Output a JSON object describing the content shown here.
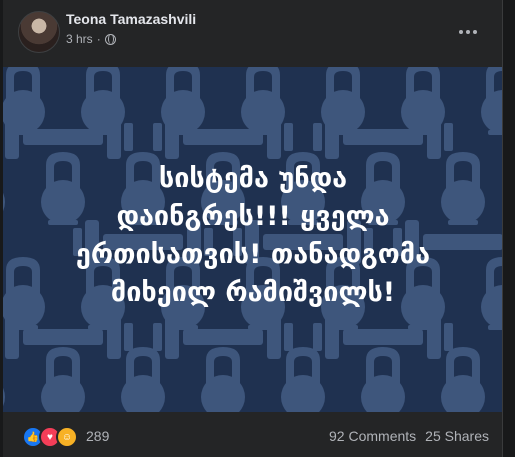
{
  "post": {
    "author": "Teona Tamazashvili",
    "time": "3 hrs",
    "privacy_icon": "globe-icon"
  },
  "image": {
    "text": "სისტემა უნდა\nდაინგრეს!!! ყველა\nერთისათვის! თანადგომა\nმიხეილ რამიშვილს!",
    "background_color": "#1f3150",
    "pattern_color": "#3e567c",
    "pattern_icon": "kettlebell-icon"
  },
  "footer": {
    "reaction_icons": [
      "like-icon",
      "love-icon",
      "care-icon"
    ],
    "reaction_count": "289",
    "comments": "92 Comments",
    "shares": "25 Shares"
  }
}
